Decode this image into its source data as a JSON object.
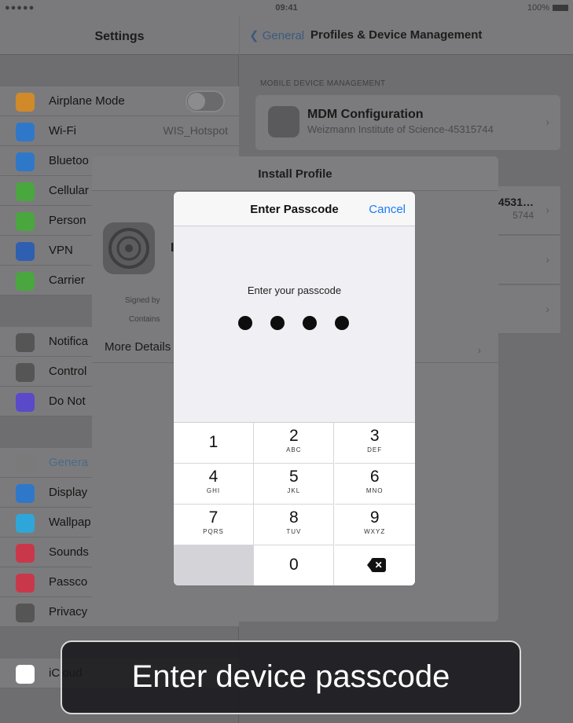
{
  "status_bar": {
    "signal": "●●●●● ",
    "time": "09:41",
    "battery": "100%"
  },
  "settings": {
    "title": "Settings",
    "items": [
      {
        "label": "Airplane Mode",
        "value": "",
        "icon": "airplane-icon",
        "color": "#d08a2a",
        "toggle": true
      },
      {
        "label": "Wi-Fi",
        "value": "WIS_Hotspot",
        "icon": "wifi-icon",
        "color": "#2f78c9"
      },
      {
        "label": "Bluetoo",
        "value": "",
        "icon": "bluetooth-icon",
        "color": "#2f78c9"
      },
      {
        "label": "Cellular",
        "value": "",
        "icon": "cellular-icon",
        "color": "#4aa63f"
      },
      {
        "label": "Person",
        "value": "",
        "icon": "hotspot-icon",
        "color": "#4aa63f"
      },
      {
        "label": "VPN",
        "value": "",
        "icon": "vpn-icon",
        "color": "#2f5fb0"
      },
      {
        "label": "Carrier",
        "value": "",
        "icon": "phone-icon",
        "color": "#4aa63f"
      },
      {
        "label": "Notifica",
        "value": "",
        "icon": "notifications-icon",
        "color": "#555"
      },
      {
        "label": "Control",
        "value": "",
        "icon": "control-center-icon",
        "color": "#555"
      },
      {
        "label": "Do Not",
        "value": "",
        "icon": "moon-icon",
        "color": "#5a4ac9"
      },
      {
        "label": "Genera",
        "value": "",
        "icon": "gear-icon",
        "color": "#7a7a7a",
        "selected": true
      },
      {
        "label": "Display",
        "value": "",
        "icon": "display-icon",
        "color": "#2f78c9"
      },
      {
        "label": "Wallpap",
        "value": "",
        "icon": "wallpaper-icon",
        "color": "#2fa6d9"
      },
      {
        "label": "Sounds",
        "value": "",
        "icon": "sounds-icon",
        "color": "#c9384a"
      },
      {
        "label": "Passco",
        "value": "",
        "icon": "lock-icon",
        "color": "#c9384a"
      },
      {
        "label": "Privacy",
        "value": "",
        "icon": "hand-icon",
        "color": "#555"
      },
      {
        "label": "iCloud",
        "value": "",
        "icon": "cloud-icon",
        "color": "#fff"
      }
    ]
  },
  "detail": {
    "back_label": "General",
    "title": "Profiles & Device Management",
    "section": "MOBILE DEVICE MANAGEMENT",
    "mdm_name": "MDM Configuration",
    "mdm_sub": "Weizmann Institute of Science-45315744",
    "row2_text": "4531…",
    "row2_sub": "5744"
  },
  "install_sheet": {
    "title": "Install Profile",
    "profile_letter": "I",
    "signed_by": "Signed by",
    "contains": "Contains",
    "more_details": "More Details"
  },
  "passcode": {
    "title": "Enter Passcode",
    "cancel": "Cancel",
    "prompt": "Enter your passcode",
    "entered_digits": 4,
    "keys": [
      {
        "num": "1",
        "letters": ""
      },
      {
        "num": "2",
        "letters": "ABC"
      },
      {
        "num": "3",
        "letters": "DEF"
      },
      {
        "num": "4",
        "letters": "GHI"
      },
      {
        "num": "5",
        "letters": "JKL"
      },
      {
        "num": "6",
        "letters": "MNO"
      },
      {
        "num": "7",
        "letters": "PQRS"
      },
      {
        "num": "8",
        "letters": "TUV"
      },
      {
        "num": "9",
        "letters": "WXYZ"
      },
      {
        "num": "",
        "letters": ""
      },
      {
        "num": "0",
        "letters": ""
      },
      {
        "num": "delete",
        "letters": ""
      }
    ]
  },
  "caption": {
    "text": "Enter device passcode"
  },
  "colors": {
    "accent": "#1a7cf5",
    "dim_bg": "#6e6e70"
  }
}
